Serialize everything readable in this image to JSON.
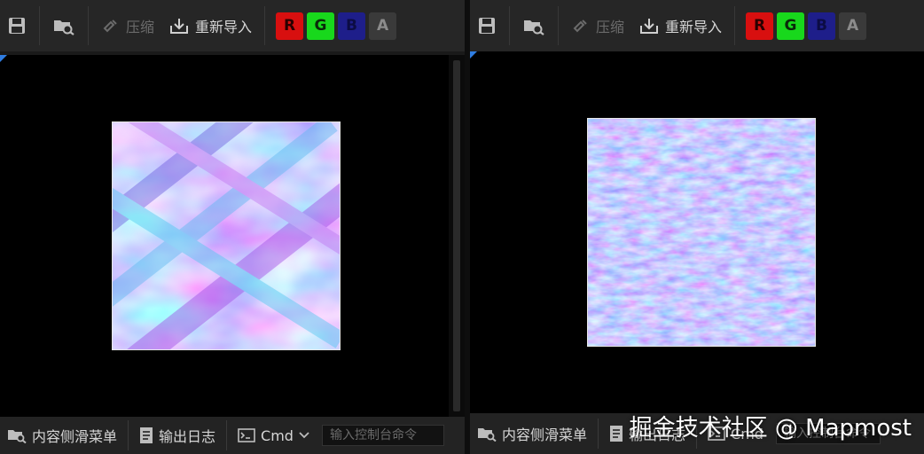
{
  "toolbar": {
    "compress_label": "压缩",
    "reimport_label": "重新导入",
    "channels": {
      "r": "R",
      "g": "G",
      "b": "B",
      "a": "A"
    }
  },
  "bottombar": {
    "content_drawer_label": "内容侧滑菜单",
    "output_log_label": "输出日志",
    "cmd_label": "Cmd",
    "console_placeholder": "输入控制台命令"
  },
  "watermark": "掘金技术社区 @ Mapmost",
  "colors": {
    "toolbar_bg": "#262626",
    "viewport_bg": "#000000",
    "channel_r": "#d80f0f",
    "channel_g": "#18d81c",
    "channel_b": "#1e1e8a",
    "channel_a": "#3a3a3a",
    "corner_accent": "#2f7de1"
  },
  "icons": [
    "save-icon",
    "browse-asset-icon",
    "compress-icon",
    "reimport-icon",
    "content-drawer-icon",
    "output-log-icon",
    "cmd-icon",
    "chevron-down-icon"
  ]
}
